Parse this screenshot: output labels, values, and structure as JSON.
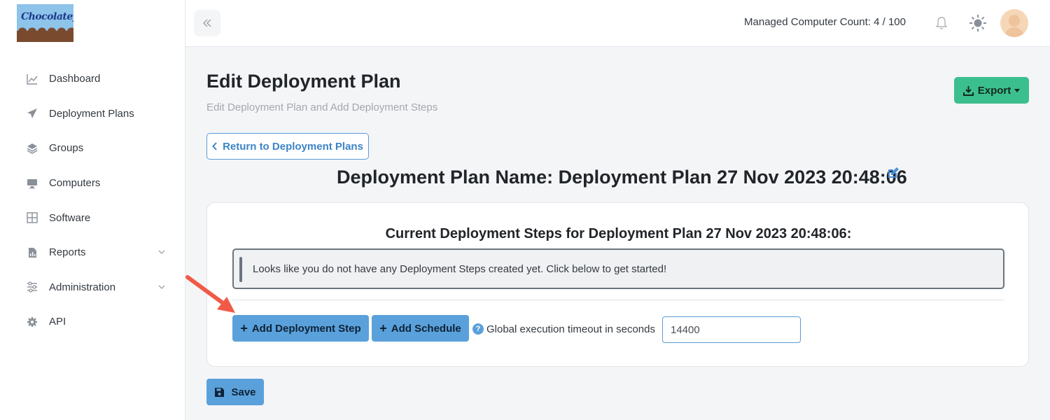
{
  "sidebar": {
    "logo_text": "Chocolatey",
    "items": [
      {
        "label": "Dashboard",
        "icon": "chart-line-icon"
      },
      {
        "label": "Deployment Plans",
        "icon": "paper-plane-icon"
      },
      {
        "label": "Groups",
        "icon": "layers-icon"
      },
      {
        "label": "Computers",
        "icon": "desktop-icon"
      },
      {
        "label": "Software",
        "icon": "grid-icon"
      },
      {
        "label": "Reports",
        "icon": "file-report-icon",
        "expandable": true
      },
      {
        "label": "Administration",
        "icon": "sliders-icon",
        "expandable": true
      },
      {
        "label": "API",
        "icon": "gear-icon"
      }
    ]
  },
  "topbar": {
    "computer_count": "Managed Computer Count: 4 / 100"
  },
  "header": {
    "title": "Edit Deployment Plan",
    "subtitle": "Edit Deployment Plan and Add Deployment Steps",
    "export_label": "Export"
  },
  "main": {
    "return_label": "Return to Deployment Plans",
    "plan_name": "Deployment Plan Name: Deployment Plan 27 Nov 2023 20:48:06",
    "steps_title": "Current Deployment Steps for Deployment Plan 27 Nov 2023 20:48:06:",
    "empty_message": "Looks like you do not have any Deployment Steps created yet. Click below to get started!",
    "add_step_label": "Add Deployment Step",
    "add_schedule_label": "Add Schedule",
    "help_glyph": "?",
    "timeout_label": "Global execution timeout in seconds",
    "timeout_value": "14400",
    "save_label": "Save"
  },
  "colors": {
    "accent_blue": "#5aa1db",
    "export_green": "#3cbf8f",
    "annotation_arrow": "#f05a47"
  }
}
